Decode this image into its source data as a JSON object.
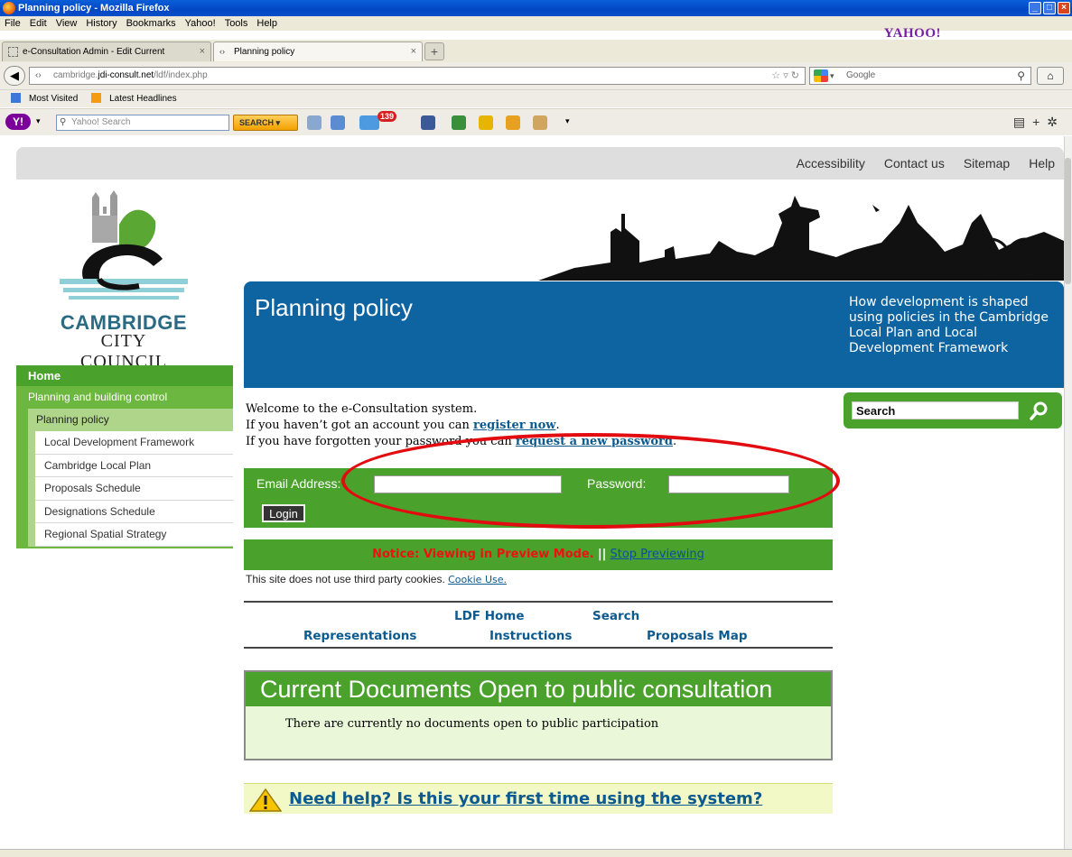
{
  "browser": {
    "window_title": "Planning policy - Mozilla Firefox",
    "menu": [
      "File",
      "Edit",
      "View",
      "History",
      "Bookmarks",
      "Yahoo!",
      "Tools",
      "Help"
    ],
    "yahoo_brand": "YAHOO!",
    "tabs": [
      {
        "label": "e-Consultation Admin - Edit Current",
        "active": false
      },
      {
        "label": "Planning policy",
        "active": true
      }
    ],
    "url": {
      "prefix": "cambridge.",
      "host": "jdi-consult.net",
      "path": "/ldf/index.php"
    },
    "search_engine_placeholder": "Google",
    "bookmarks": [
      {
        "label": "Most Visited",
        "icon": "bookmark-folder-icon"
      },
      {
        "label": "Latest Headlines",
        "icon": "rss-feed-icon"
      }
    ],
    "yahoo_toolbar": {
      "search_placeholder": "Yahoo! Search",
      "search_button": "SEARCH",
      "mail_badge": "139"
    }
  },
  "site": {
    "top_links": [
      "Accessibility",
      "Contact us",
      "Sitemap",
      "Help"
    ],
    "council_name_line1": "CAMBRIDGE",
    "council_name_line2": "CITY COUNCIL",
    "banner_title": "Planning policy",
    "banner_description": "How development is shaped using policies in the Cambridge Local Plan and Local Development Framework",
    "nav": {
      "home": "Home",
      "level1": "Planning and building control",
      "level2": "Planning policy",
      "level3": [
        "Local Development Framework",
        "Cambridge Local Plan",
        "Proposals Schedule",
        "Designations Schedule",
        "Regional Spatial Strategy"
      ]
    },
    "search_value": "Search"
  },
  "main": {
    "welcome_line1": "Welcome to the e-Consultation system.",
    "welcome_line2_pre": "If you haven’t got an account you can ",
    "register_link": "register now",
    "welcome_line2_post": ".",
    "welcome_line3_pre": "If you have forgotten your password you can ",
    "reset_link": "request a new password",
    "welcome_line3_post": ".",
    "login": {
      "email_label": "Email Address:",
      "email_value": "",
      "password_label": "Password:",
      "password_value": "",
      "button": "Login"
    },
    "notice_text": "Notice: Viewing in Preview Mode.",
    "notice_separator": "||",
    "stop_preview_link": "Stop Previewing",
    "cookie_text": "This site does not use third party cookies. ",
    "cookie_link": "Cookie Use.",
    "ldf_nav": [
      "LDF Home",
      "Search",
      "Representations",
      "Instructions",
      "Proposals Map"
    ],
    "current_docs_title": "Current Documents Open to public consultation",
    "current_docs_body": "There are currently no documents open to public participation",
    "help_link": "Need help? Is this your first time using the system?"
  },
  "colors": {
    "green": "#4aa22c",
    "light_green": "#aed58a",
    "blue": "#0e63a1",
    "link": "#0d5a8f",
    "annotation_ring": "#e10b10"
  }
}
